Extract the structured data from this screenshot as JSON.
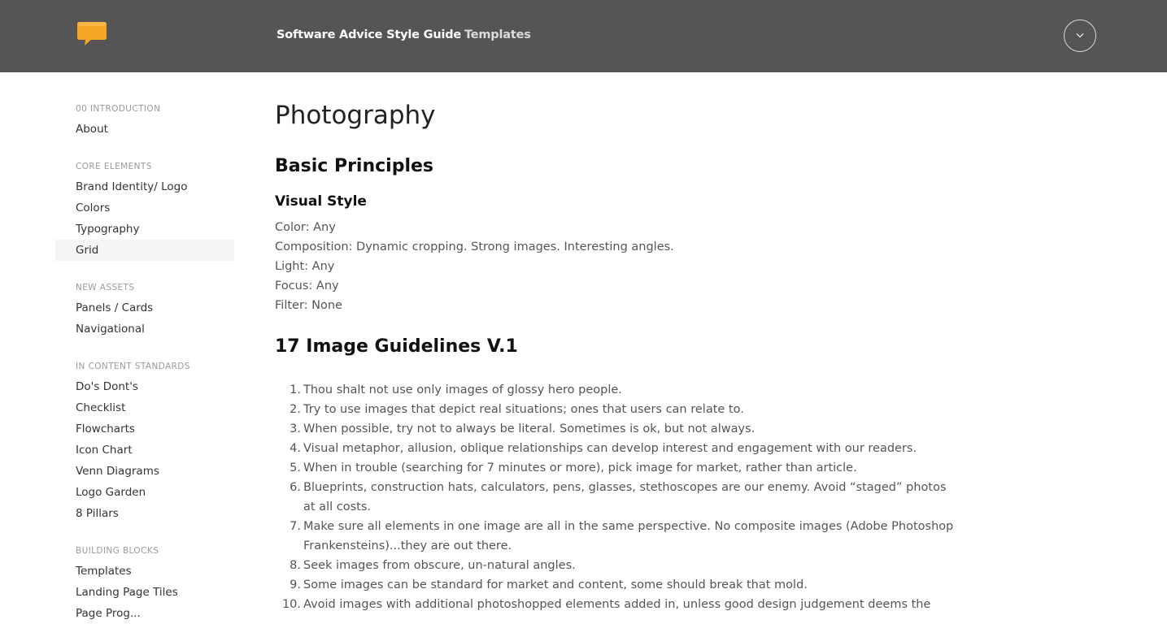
{
  "header": {
    "brand_label": "Software Advice Style Guide",
    "templates_label": "Templates",
    "logo_icon": "speech-bubble-icon",
    "menu_icon": "chevron-down-icon",
    "colors": {
      "bar": "#555555",
      "logo": "#f5a623"
    }
  },
  "sidebar": {
    "sections": [
      {
        "title": "00 INTRODUCTION",
        "items": [
          "About"
        ]
      },
      {
        "title": "CORE ELEMENTS",
        "items": [
          "Brand Identity/ Logo",
          "Colors",
          "Typography",
          "Grid"
        ]
      },
      {
        "title": "NEW ASSETS",
        "items": [
          "Panels / Cards",
          "Navigational"
        ]
      },
      {
        "title": "IN CONTENT STANDARDS",
        "items": [
          "Do's Dont's",
          "Checklist",
          "Flowcharts",
          "Icon Chart",
          "Venn Diagrams",
          "Logo Garden",
          "8 Pillars"
        ]
      },
      {
        "title": "BUILDING BLOCKS",
        "items": [
          "Templates",
          "Landing Page Tiles",
          "Page Prog..."
        ]
      }
    ],
    "active_item": "Grid"
  },
  "main": {
    "title": "Photography",
    "basic_heading": "Basic Principles",
    "visual_heading": "Visual Style",
    "visual_lines": [
      "Color: Any",
      "Composition: Dynamic cropping. Strong images. Interesting angles.",
      "Light: Any",
      "Focus: Any",
      "Filter: None"
    ],
    "guidelines_heading": "17 Image Guidelines V.1",
    "guidelines": [
      "Thou shalt not use only images of glossy hero people.",
      "Try to use images that depict real situations; ones that users can relate to.",
      "When possible, try not to always be literal. Sometimes is ok, but not always.",
      "Visual metaphor, allusion, oblique relationships can develop interest and engagement with our readers.",
      "When in trouble (searching for 7 minutes or more), pick image for market, rather than article.",
      "Blueprints, construction hats, calculators, pens, glasses, stethoscopes are our enemy. Avoid “staged” photos at all costs.",
      "Make sure all elements in one image are all in the same perspective. No composite images (Adobe Photoshop Frankensteins)...they are out there.",
      "Seek images from obscure, un-natural angles.",
      "Some images can be standard for market and content, some should break that mold.",
      "Avoid images with additional photoshopped elements added in, unless good design judgement deems the"
    ]
  }
}
